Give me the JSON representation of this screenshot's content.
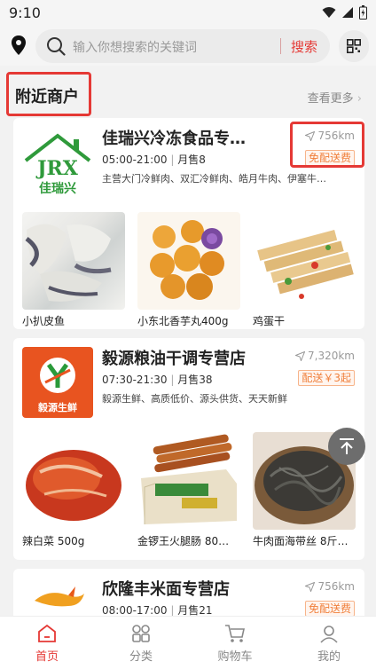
{
  "status": {
    "time": "9:10"
  },
  "search": {
    "placeholder": "输入你想搜索的关键词",
    "button": "搜索"
  },
  "section": {
    "title": "附近商户",
    "see_more": "查看更多"
  },
  "merchants": [
    {
      "name": "佳瑞兴冷冻食品专…",
      "hours": "05:00-21:00",
      "sold": "月售8",
      "desc": "主营大门冷鲜肉、双汇冷鲜肉、皓月牛肉、伊塞牛…",
      "distance": "756km",
      "badge": "免配送费",
      "logo_text": "JRX",
      "logo_sub": "佳瑞兴",
      "products": [
        {
          "name": "小扒皮鱼"
        },
        {
          "name": "小东北香芋丸400g"
        },
        {
          "name": "鸡蛋干"
        }
      ]
    },
    {
      "name": "毅源粮油干调专营店",
      "hours": "07:30-21:30",
      "sold": "月售38",
      "desc": "毅源生鲜、高质低价、源头供货、天天新鲜",
      "distance": "7,320km",
      "badge": "配送￥3起",
      "logo_text": "毅源生鲜",
      "products": [
        {
          "name": "辣白菜 500g"
        },
        {
          "name": "金锣王火腿肠 80…"
        },
        {
          "name": "牛肉面海带丝 8斤…"
        }
      ]
    },
    {
      "name": "欣隆丰米面专营店",
      "hours": "08:00-17:00",
      "sold": "月售21",
      "distance": "756km",
      "badge": "免配送费"
    }
  ],
  "tabs": [
    {
      "label": "首页"
    },
    {
      "label": "分类"
    },
    {
      "label": "购物车"
    },
    {
      "label": "我的"
    }
  ],
  "colors": {
    "accent": "#e53935",
    "badge": "#f0803c"
  }
}
